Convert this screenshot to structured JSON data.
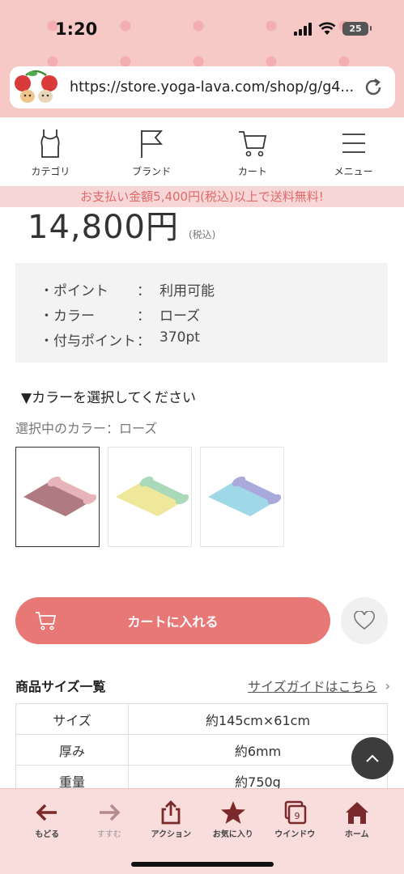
{
  "status_bar": {
    "time": "1:20",
    "battery": "25"
  },
  "browser": {
    "url": "https://store.yoga-lava.com/shop/g/g4..."
  },
  "site_nav": {
    "items": [
      {
        "label": "カテゴリ",
        "icon": "tank-top-icon"
      },
      {
        "label": "ブランド",
        "icon": "flag-icon"
      },
      {
        "label": "カート",
        "icon": "cart-icon"
      },
      {
        "label": "メニュー",
        "icon": "menu-icon"
      }
    ]
  },
  "banner": {
    "shipping": "お支払い金額5,400円(税込)以上で送料無料!"
  },
  "product": {
    "price": "14,800円",
    "tax_note": "(税込)",
    "info": [
      {
        "key": "・ポイント",
        "value": "利用可能"
      },
      {
        "key": "・カラー",
        "value": "ローズ"
      },
      {
        "key": "・付与ポイント",
        "value": "370pt"
      }
    ],
    "color_heading": "▼カラーを選択してください",
    "selected_color": "選択中のカラー：ローズ",
    "swatches": [
      {
        "name": "rose",
        "mat": "#b07a82",
        "roll": "#e6b4b9",
        "selected": true
      },
      {
        "name": "yellow",
        "mat": "#efe89a",
        "roll": "#a9d9b8",
        "selected": false
      },
      {
        "name": "blue",
        "mat": "#9fd8e6",
        "roll": "#a9a9dc",
        "selected": false
      }
    ],
    "cart_button": "カートに入れる"
  },
  "size": {
    "title": "商品サイズ一覧",
    "guide_link": "サイズガイドはこちら",
    "guide_chevron": "›",
    "rows": [
      {
        "key": "サイズ",
        "value": "約145cm×61cm"
      },
      {
        "key": "厚み",
        "value": "約6mm"
      },
      {
        "key": "重量",
        "value": "約750g"
      }
    ]
  },
  "bottom_bar": {
    "items": [
      {
        "label": "もどる",
        "icon": "arrow-left-icon"
      },
      {
        "label": "すすむ",
        "icon": "arrow-right-icon"
      },
      {
        "label": "アクション",
        "icon": "share-icon"
      },
      {
        "label": "お気に入り",
        "icon": "star-icon"
      },
      {
        "label": "ウインドウ",
        "icon": "windows-icon",
        "count": "9"
      },
      {
        "label": "ホーム",
        "icon": "home-icon"
      }
    ]
  },
  "colors": {
    "accent": "#e87876",
    "banner_text": "#e06a6a",
    "chrome": "#f6c9c7",
    "toolbar_icons": "#7a2a2a"
  }
}
